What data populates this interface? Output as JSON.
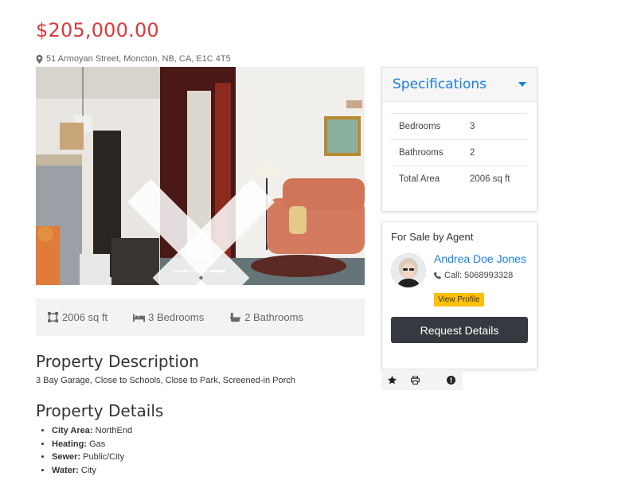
{
  "listing": {
    "price": "$205,000.00",
    "address": "51 Armoyan Street, Moncton, NB, CA, E1C 4T5"
  },
  "gallery": {
    "slide_count": 3,
    "active_slide": 3
  },
  "stats": {
    "area": "2006 sq ft",
    "bedrooms": "3 Bedrooms",
    "bathrooms": "2 Bathrooms"
  },
  "description": {
    "heading": "Property Description",
    "text": "3 Bay Garage, Close to Schools, Close to Park, Screened-in Porch"
  },
  "details": {
    "heading": "Property Details",
    "items": [
      {
        "label": "City Area:",
        "value": "NorthEnd"
      },
      {
        "label": "Heating:",
        "value": "Gas"
      },
      {
        "label": "Sewer:",
        "value": "Public/City"
      },
      {
        "label": "Water:",
        "value": "City"
      }
    ]
  },
  "specifications": {
    "title": "Specifications",
    "rows": [
      {
        "label": "Bedrooms",
        "value": "3"
      },
      {
        "label": "Bathrooms",
        "value": "2"
      },
      {
        "label": "Total Area",
        "value": "2006 sq ft"
      }
    ]
  },
  "agent": {
    "heading": "For Sale by Agent",
    "name": "Andrea Doe Jones",
    "call": "Call: 5068993328",
    "view_profile": "View Profile",
    "request_details": "Request Details"
  },
  "colors": {
    "price": "#d9393b",
    "link": "#1a7fe0",
    "view_profile_bg": "#ffc107",
    "request_bg": "#343a40"
  }
}
